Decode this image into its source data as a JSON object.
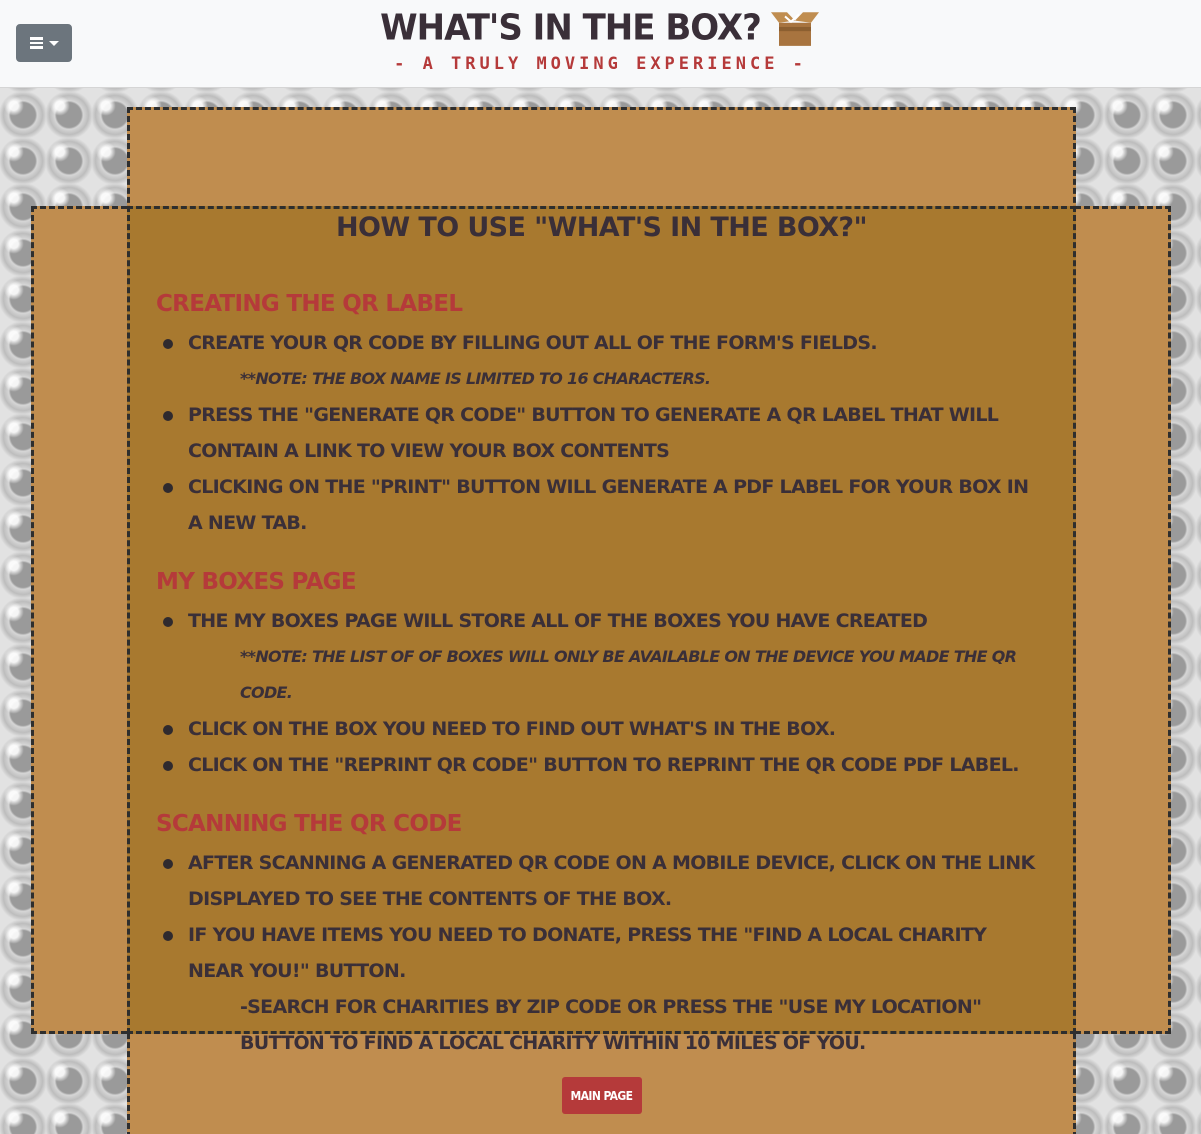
{
  "header": {
    "title": "WHAT'S IN THE BOX?",
    "subtitle": "- A TRULY MOVING EXPERIENCE -"
  },
  "page": {
    "title": "HOW TO USE \"WHAT'S IN THE BOX?\"",
    "sections": [
      {
        "title": "CREATING THE QR LABEL",
        "items": [
          "CREATE YOUR QR CODE BY FILLING OUT ALL OF THE FORM'S FIELDS.",
          "**NOTE: THE BOX NAME IS LIMITED TO 16 CHARACTERS.",
          "PRESS THE \"GENERATE QR CODE\" BUTTON TO GENERATE A QR LABEL THAT WILL CONTAIN A LINK TO VIEW YOUR BOX CONTENTS",
          "CLICKING ON THE \"PRINT\" BUTTON WILL GENERATE A PDF LABEL FOR YOUR BOX IN A NEW TAB."
        ]
      },
      {
        "title": "MY BOXES PAGE",
        "items": [
          "THE MY BOXES PAGE WILL STORE ALL OF THE BOXES YOU HAVE CREATED",
          "**NOTE: THE LIST OF OF BOXES WILL ONLY BE AVAILABLE ON THE DEVICE YOU MADE THE QR CODE.",
          "CLICK ON THE BOX YOU NEED TO FIND OUT WHAT'S IN THE BOX.",
          "CLICK ON THE \"REPRINT QR CODE\" BUTTON TO REPRINT THE QR CODE PDF LABEL."
        ]
      },
      {
        "title": "SCANNING THE QR CODE",
        "items": [
          "AFTER SCANNING A GENERATED QR CODE ON A MOBILE DEVICE, CLICK ON THE LINK DISPLAYED TO SEE THE CONTENTS OF THE BOX.",
          "IF YOU HAVE ITEMS YOU NEED TO DONATE, PRESS THE \"FIND A LOCAL CHARITY NEAR YOU!\" BUTTON.",
          "-SEARCH FOR CHARITIES BY ZIP CODE OR PRESS THE \"USE MY LOCATION\" BUTTON TO FIND A LOCAL CHARITY WITHIN 10 MILES OF YOU."
        ]
      }
    ],
    "main_button": "MAIN PAGE"
  },
  "colors": {
    "accent_red": "#b53a3a",
    "cardboard": "#c08d4f",
    "cardboard_dark": "#a8792f",
    "text_dark": "#3a2f38"
  },
  "icons": {
    "menu": "hamburger-icon",
    "dropdown": "caret-down-icon",
    "brand": "open-box-icon"
  }
}
